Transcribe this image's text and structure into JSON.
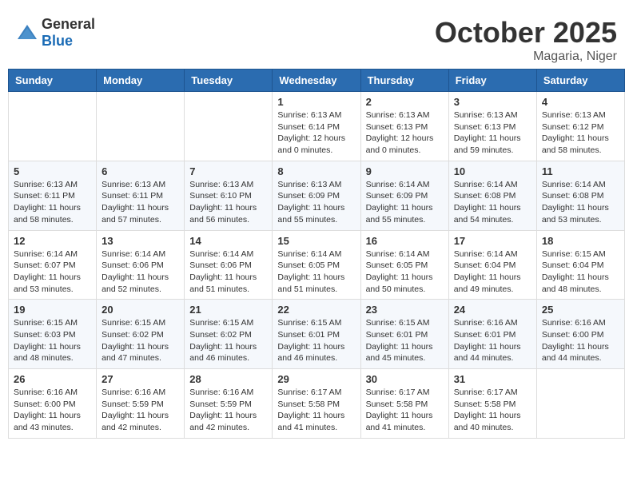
{
  "header": {
    "logo_general": "General",
    "logo_blue": "Blue",
    "month": "October 2025",
    "location": "Magaria, Niger"
  },
  "weekdays": [
    "Sunday",
    "Monday",
    "Tuesday",
    "Wednesday",
    "Thursday",
    "Friday",
    "Saturday"
  ],
  "weeks": [
    [
      {
        "day": "",
        "info": ""
      },
      {
        "day": "",
        "info": ""
      },
      {
        "day": "",
        "info": ""
      },
      {
        "day": "1",
        "info": "Sunrise: 6:13 AM\nSunset: 6:14 PM\nDaylight: 12 hours\nand 0 minutes."
      },
      {
        "day": "2",
        "info": "Sunrise: 6:13 AM\nSunset: 6:13 PM\nDaylight: 12 hours\nand 0 minutes."
      },
      {
        "day": "3",
        "info": "Sunrise: 6:13 AM\nSunset: 6:13 PM\nDaylight: 11 hours\nand 59 minutes."
      },
      {
        "day": "4",
        "info": "Sunrise: 6:13 AM\nSunset: 6:12 PM\nDaylight: 11 hours\nand 58 minutes."
      }
    ],
    [
      {
        "day": "5",
        "info": "Sunrise: 6:13 AM\nSunset: 6:11 PM\nDaylight: 11 hours\nand 58 minutes."
      },
      {
        "day": "6",
        "info": "Sunrise: 6:13 AM\nSunset: 6:11 PM\nDaylight: 11 hours\nand 57 minutes."
      },
      {
        "day": "7",
        "info": "Sunrise: 6:13 AM\nSunset: 6:10 PM\nDaylight: 11 hours\nand 56 minutes."
      },
      {
        "day": "8",
        "info": "Sunrise: 6:13 AM\nSunset: 6:09 PM\nDaylight: 11 hours\nand 55 minutes."
      },
      {
        "day": "9",
        "info": "Sunrise: 6:14 AM\nSunset: 6:09 PM\nDaylight: 11 hours\nand 55 minutes."
      },
      {
        "day": "10",
        "info": "Sunrise: 6:14 AM\nSunset: 6:08 PM\nDaylight: 11 hours\nand 54 minutes."
      },
      {
        "day": "11",
        "info": "Sunrise: 6:14 AM\nSunset: 6:08 PM\nDaylight: 11 hours\nand 53 minutes."
      }
    ],
    [
      {
        "day": "12",
        "info": "Sunrise: 6:14 AM\nSunset: 6:07 PM\nDaylight: 11 hours\nand 53 minutes."
      },
      {
        "day": "13",
        "info": "Sunrise: 6:14 AM\nSunset: 6:06 PM\nDaylight: 11 hours\nand 52 minutes."
      },
      {
        "day": "14",
        "info": "Sunrise: 6:14 AM\nSunset: 6:06 PM\nDaylight: 11 hours\nand 51 minutes."
      },
      {
        "day": "15",
        "info": "Sunrise: 6:14 AM\nSunset: 6:05 PM\nDaylight: 11 hours\nand 51 minutes."
      },
      {
        "day": "16",
        "info": "Sunrise: 6:14 AM\nSunset: 6:05 PM\nDaylight: 11 hours\nand 50 minutes."
      },
      {
        "day": "17",
        "info": "Sunrise: 6:14 AM\nSunset: 6:04 PM\nDaylight: 11 hours\nand 49 minutes."
      },
      {
        "day": "18",
        "info": "Sunrise: 6:15 AM\nSunset: 6:04 PM\nDaylight: 11 hours\nand 48 minutes."
      }
    ],
    [
      {
        "day": "19",
        "info": "Sunrise: 6:15 AM\nSunset: 6:03 PM\nDaylight: 11 hours\nand 48 minutes."
      },
      {
        "day": "20",
        "info": "Sunrise: 6:15 AM\nSunset: 6:02 PM\nDaylight: 11 hours\nand 47 minutes."
      },
      {
        "day": "21",
        "info": "Sunrise: 6:15 AM\nSunset: 6:02 PM\nDaylight: 11 hours\nand 46 minutes."
      },
      {
        "day": "22",
        "info": "Sunrise: 6:15 AM\nSunset: 6:01 PM\nDaylight: 11 hours\nand 46 minutes."
      },
      {
        "day": "23",
        "info": "Sunrise: 6:15 AM\nSunset: 6:01 PM\nDaylight: 11 hours\nand 45 minutes."
      },
      {
        "day": "24",
        "info": "Sunrise: 6:16 AM\nSunset: 6:01 PM\nDaylight: 11 hours\nand 44 minutes."
      },
      {
        "day": "25",
        "info": "Sunrise: 6:16 AM\nSunset: 6:00 PM\nDaylight: 11 hours\nand 44 minutes."
      }
    ],
    [
      {
        "day": "26",
        "info": "Sunrise: 6:16 AM\nSunset: 6:00 PM\nDaylight: 11 hours\nand 43 minutes."
      },
      {
        "day": "27",
        "info": "Sunrise: 6:16 AM\nSunset: 5:59 PM\nDaylight: 11 hours\nand 42 minutes."
      },
      {
        "day": "28",
        "info": "Sunrise: 6:16 AM\nSunset: 5:59 PM\nDaylight: 11 hours\nand 42 minutes."
      },
      {
        "day": "29",
        "info": "Sunrise: 6:17 AM\nSunset: 5:58 PM\nDaylight: 11 hours\nand 41 minutes."
      },
      {
        "day": "30",
        "info": "Sunrise: 6:17 AM\nSunset: 5:58 PM\nDaylight: 11 hours\nand 41 minutes."
      },
      {
        "day": "31",
        "info": "Sunrise: 6:17 AM\nSunset: 5:58 PM\nDaylight: 11 hours\nand 40 minutes."
      },
      {
        "day": "",
        "info": ""
      }
    ]
  ]
}
